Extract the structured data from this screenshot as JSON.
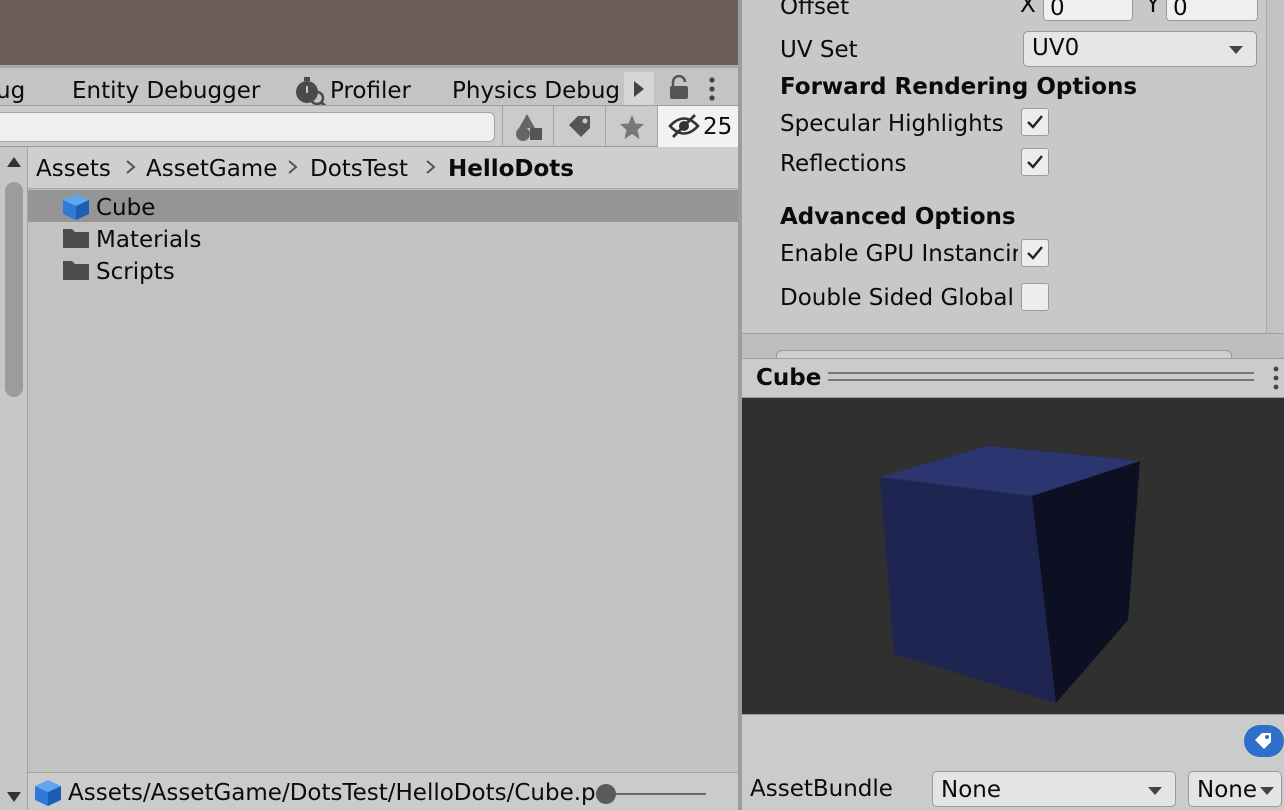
{
  "tabs": {
    "partial": "ug",
    "entity_debugger": "Entity Debugger",
    "profiler": "Profiler",
    "physics_debug": "Physics Debug"
  },
  "toolbar": {
    "search_placeholder": "",
    "hidden_count": "25"
  },
  "breadcrumb": [
    "Assets",
    "AssetGame",
    "DotsTest",
    "HelloDots"
  ],
  "files": [
    {
      "name": "Cube",
      "icon": "prefab-cube-icon",
      "selected": true
    },
    {
      "name": "Materials",
      "icon": "folder-icon",
      "selected": false
    },
    {
      "name": "Scripts",
      "icon": "folder-icon",
      "selected": false
    }
  ],
  "status_path": "Assets/AssetGame/DotsTest/HelloDots/Cube.p",
  "inspector": {
    "offset_label": "Offset",
    "offset_x_label": "X",
    "offset_x": "0",
    "offset_y_label": "Y",
    "offset_y": "0",
    "uvset_label": "UV Set",
    "uvset_value": "UV0",
    "forward_header": "Forward Rendering Options",
    "specular_label": "Specular Highlights",
    "specular_checked": true,
    "reflections_label": "Reflections",
    "reflections_checked": true,
    "advanced_header": "Advanced Options",
    "gpu_label": "Enable GPU Instancir",
    "gpu_checked": true,
    "double_label": "Double Sided Global I",
    "double_checked": false
  },
  "preview": {
    "title": "Cube"
  },
  "assetbundle": {
    "label": "AssetBundle",
    "name_value": "None",
    "variant_value": "None"
  },
  "colors": {
    "cube_top": "#2b3570",
    "cube_front": "#1e2550",
    "cube_side": "#0d0f22",
    "accent_blue": "#2e6fc9"
  }
}
